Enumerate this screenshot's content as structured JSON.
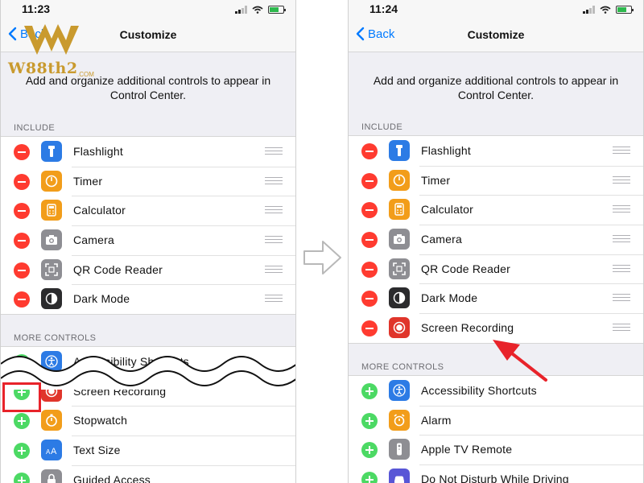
{
  "left_screen": {
    "time": "11:23",
    "back_label": "Back",
    "title": "Customize",
    "description": "Add and organize additional controls to appear in Control Center.",
    "include_label": "INCLUDE",
    "include": [
      {
        "label": "Flashlight",
        "icon": "flashlight-icon"
      },
      {
        "label": "Timer",
        "icon": "timer-icon"
      },
      {
        "label": "Calculator",
        "icon": "calculator-icon"
      },
      {
        "label": "Camera",
        "icon": "camera-icon"
      },
      {
        "label": "QR Code Reader",
        "icon": "qr-code-icon"
      },
      {
        "label": "Dark Mode",
        "icon": "dark-mode-icon"
      }
    ],
    "more_label": "MORE CONTROLS",
    "more": [
      {
        "label": "Accessibility Shortcuts",
        "icon": "accessibility-icon"
      },
      {
        "label": "Screen Recording",
        "icon": "screen-recording-icon"
      },
      {
        "label": "Stopwatch",
        "icon": "stopwatch-icon"
      },
      {
        "label": "Text Size",
        "icon": "text-size-icon"
      },
      {
        "label": "Guided Access",
        "icon": "guided-access-icon"
      }
    ]
  },
  "right_screen": {
    "time": "11:24",
    "back_label": "Back",
    "title": "Customize",
    "description": "Add and organize additional controls to appear in Control Center.",
    "include_label": "INCLUDE",
    "include": [
      {
        "label": "Flashlight",
        "icon": "flashlight-icon"
      },
      {
        "label": "Timer",
        "icon": "timer-icon"
      },
      {
        "label": "Calculator",
        "icon": "calculator-icon"
      },
      {
        "label": "Camera",
        "icon": "camera-icon"
      },
      {
        "label": "QR Code Reader",
        "icon": "qr-code-icon"
      },
      {
        "label": "Dark Mode",
        "icon": "dark-mode-icon"
      },
      {
        "label": "Screen Recording",
        "icon": "screen-recording-icon"
      }
    ],
    "more_label": "MORE CONTROLS",
    "more": [
      {
        "label": "Accessibility Shortcuts",
        "icon": "accessibility-icon"
      },
      {
        "label": "Alarm",
        "icon": "alarm-icon"
      },
      {
        "label": "Apple TV Remote",
        "icon": "apple-tv-remote-icon"
      },
      {
        "label": "Do Not Disturb While Driving",
        "icon": "car-icon"
      }
    ]
  },
  "watermark": {
    "text": "W88th2",
    "suffix": ".COM"
  },
  "colors": {
    "accent": "#007aff",
    "remove": "#ff3b30",
    "add": "#4cd964",
    "highlight": "#e8232a",
    "logo_gold": "#c99a2e"
  }
}
